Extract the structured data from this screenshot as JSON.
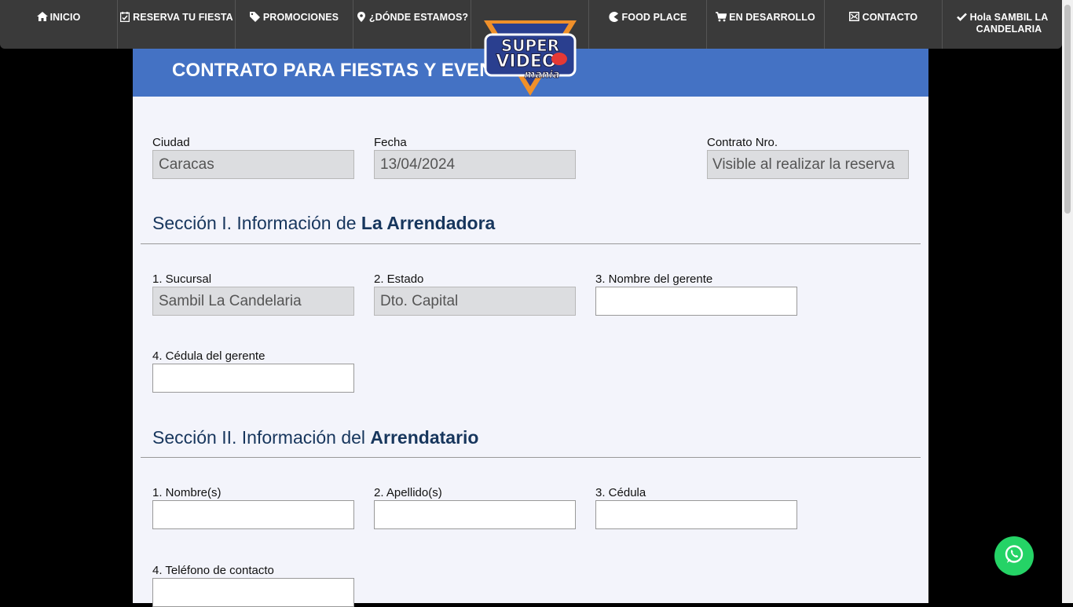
{
  "nav": {
    "items": [
      {
        "label": "INICIO",
        "icon": "home-icon"
      },
      {
        "label": "RESERVA TU FIESTA",
        "icon": "calendar-check-icon"
      },
      {
        "label": "PROMOCIONES",
        "icon": "tag-icon"
      },
      {
        "label": "¿DÓNDE ESTAMOS?",
        "icon": "map-pin-icon"
      },
      {
        "label": "FOOD PLACE",
        "icon": "pacman-icon"
      },
      {
        "label": "EN DESARROLLO",
        "icon": "cart-icon"
      },
      {
        "label": "CONTACTO",
        "icon": "mail-icon"
      },
      {
        "label": "Hola SAMBIL LA CANDELARIA",
        "icon": "check-icon"
      }
    ]
  },
  "logo": {
    "line1": "SUPER",
    "line2": "VIDEO",
    "line3": "mania"
  },
  "header": {
    "title": "CONTRATO PARA FIESTAS Y EVENTOS"
  },
  "top_fields": {
    "ciudad": {
      "label": "Ciudad",
      "value": "Caracas"
    },
    "fecha": {
      "label": "Fecha",
      "value": "13/04/2024"
    },
    "contrato": {
      "label": "Contrato Nro.",
      "value": "Visible al realizar la reserva"
    }
  },
  "section1": {
    "title_prefix": "Sección I. Información de ",
    "title_bold": "La Arrendadora",
    "sucursal": {
      "label": "1. Sucursal",
      "value": "Sambil La Candelaria"
    },
    "estado": {
      "label": "2. Estado",
      "value": "Dto. Capital"
    },
    "gerente": {
      "label": "3. Nombre del gerente",
      "value": ""
    },
    "cedula_gerente": {
      "label": "4. Cédula del gerente",
      "value": ""
    }
  },
  "section2": {
    "title_prefix": "Sección II. Información del ",
    "title_bold": "Arrendatario",
    "nombre": {
      "label": "1. Nombre(s)",
      "value": ""
    },
    "apellido": {
      "label": "2. Apellido(s)",
      "value": ""
    },
    "cedula": {
      "label": "3. Cédula",
      "value": ""
    },
    "telefono": {
      "label": "4. Teléfono de contacto",
      "value": ""
    }
  },
  "colors": {
    "nav_bg": "#3a3a3a",
    "header_band": "#4472c4",
    "section_title": "#17365d",
    "whatsapp": "#25d366"
  }
}
